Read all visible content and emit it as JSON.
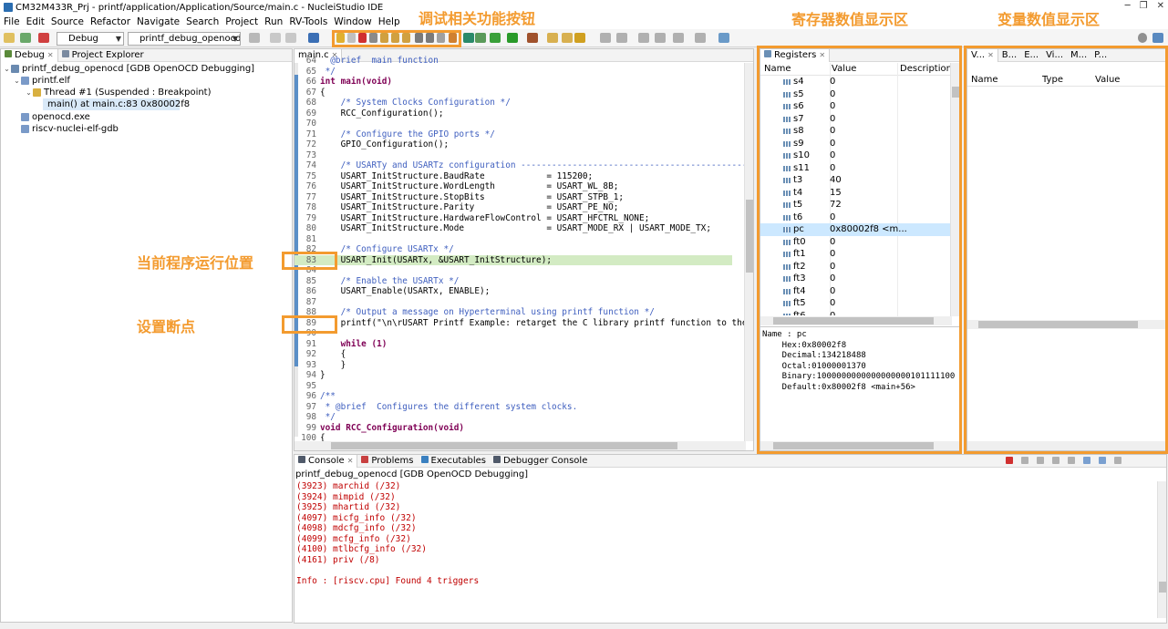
{
  "window": {
    "title": "CM32M433R_Prj - printf/application/Application/Source/main.c - NucleiStudio IDE"
  },
  "menu": [
    "File",
    "Edit",
    "Source",
    "Refactor",
    "Navigate",
    "Search",
    "Project",
    "Run",
    "RV-Tools",
    "Window",
    "Help"
  ],
  "toolbar": {
    "build_config": "Debug",
    "launch_config": "printf_debug_openocd"
  },
  "debug_view": {
    "tabs": [
      "Debug",
      "Project Explorer"
    ],
    "tree": [
      "printf_debug_openocd [GDB OpenOCD Debugging]",
      "printf.elf",
      "Thread #1 (Suspended : Breakpoint)",
      "main() at main.c:83 0x80002f8",
      "openocd.exe",
      "riscv-nuclei-elf-gdb"
    ]
  },
  "editor": {
    "tab": "main.c",
    "lines": [
      {
        "n": "64",
        "t": "  @brief  main function"
      },
      {
        "n": "65",
        "t": " */"
      },
      {
        "n": "66",
        "t": "int main(void)"
      },
      {
        "n": "67",
        "t": "{"
      },
      {
        "n": "68",
        "t": "    /* System Clocks Configuration */"
      },
      {
        "n": "69",
        "t": "    RCC_Configuration();"
      },
      {
        "n": "70",
        "t": ""
      },
      {
        "n": "71",
        "t": "    /* Configure the GPIO ports */"
      },
      {
        "n": "72",
        "t": "    GPIO_Configuration();"
      },
      {
        "n": "73",
        "t": ""
      },
      {
        "n": "74",
        "t": "    /* USARTy and USARTz configuration ------------------------------------------------"
      },
      {
        "n": "75",
        "t": "    USART_InitStructure.BaudRate            = 115200;"
      },
      {
        "n": "76",
        "t": "    USART_InitStructure.WordLength          = USART_WL_8B;"
      },
      {
        "n": "77",
        "t": "    USART_InitStructure.StopBits            = USART_STPB_1;"
      },
      {
        "n": "78",
        "t": "    USART_InitStructure.Parity              = USART_PE_NO;"
      },
      {
        "n": "79",
        "t": "    USART_InitStructure.HardwareFlowControl = USART_HFCTRL_NONE;"
      },
      {
        "n": "80",
        "t": "    USART_InitStructure.Mode                = USART_MODE_RX | USART_MODE_TX;"
      },
      {
        "n": "81",
        "t": ""
      },
      {
        "n": "82",
        "t": "    /* Configure USARTx */"
      },
      {
        "n": "83",
        "t": "    USART_Init(USARTx, &USART_InitStructure);"
      },
      {
        "n": "84",
        "t": ""
      },
      {
        "n": "85",
        "t": "    /* Enable the USARTx */"
      },
      {
        "n": "86",
        "t": "    USART_Enable(USARTx, ENABLE);"
      },
      {
        "n": "87",
        "t": ""
      },
      {
        "n": "88",
        "t": "    /* Output a message on Hyperterminal using printf function */"
      },
      {
        "n": "89",
        "t": "    printf(\"\\n\\rUSART Printf Example: retarget the C library printf function to the"
      },
      {
        "n": "90",
        "t": ""
      },
      {
        "n": "91",
        "t": "    while (1)"
      },
      {
        "n": "92",
        "t": "    {"
      },
      {
        "n": "93",
        "t": "    }"
      },
      {
        "n": "94",
        "t": "}"
      },
      {
        "n": "95",
        "t": ""
      },
      {
        "n": "96",
        "t": "/**"
      },
      {
        "n": "97",
        "t": " * @brief  Configures the different system clocks."
      },
      {
        "n": "98",
        "t": " */"
      },
      {
        "n": "99",
        "t": "void RCC_Configuration(void)"
      },
      {
        "n": "100",
        "t": "{"
      }
    ]
  },
  "registers": {
    "tab": "Registers",
    "columns": [
      "Name",
      "Value",
      "Description"
    ],
    "rows": [
      {
        "name": "s4",
        "value": "0"
      },
      {
        "name": "s5",
        "value": "0"
      },
      {
        "name": "s6",
        "value": "0"
      },
      {
        "name": "s7",
        "value": "0"
      },
      {
        "name": "s8",
        "value": "0"
      },
      {
        "name": "s9",
        "value": "0"
      },
      {
        "name": "s10",
        "value": "0"
      },
      {
        "name": "s11",
        "value": "0"
      },
      {
        "name": "t3",
        "value": "40"
      },
      {
        "name": "t4",
        "value": "15"
      },
      {
        "name": "t5",
        "value": "72"
      },
      {
        "name": "t6",
        "value": "0"
      },
      {
        "name": "pc",
        "value": "0x80002f8 <m..."
      },
      {
        "name": "ft0",
        "value": "0"
      },
      {
        "name": "ft1",
        "value": "0"
      },
      {
        "name": "ft2",
        "value": "0"
      },
      {
        "name": "ft3",
        "value": "0"
      },
      {
        "name": "ft4",
        "value": "0"
      },
      {
        "name": "ft5",
        "value": "0"
      },
      {
        "name": "ft6",
        "value": "0"
      }
    ],
    "detail": [
      "Name : pc",
      "    Hex:0x80002f8",
      "    Decimal:134218488",
      "    Octal:01000001370",
      "    Binary:1000000000000000000101111100",
      "    Default:0x80002f8 <main+56>"
    ]
  },
  "variables": {
    "tabs": [
      "V...",
      "B...",
      "E...",
      "Vi...",
      "M...",
      "P..."
    ],
    "columns": [
      "Name",
      "Type",
      "Value"
    ]
  },
  "console": {
    "tabs": [
      "Console",
      "Problems",
      "Executables",
      "Debugger Console"
    ],
    "header": "printf_debug_openocd [GDB OpenOCD Debugging]",
    "lines": [
      "(3923) marchid (/32)",
      "(3924) mimpid (/32)",
      "(3925) mhartid (/32)",
      "(4097) micfg_info (/32)",
      "(4098) mdcfg_info (/32)",
      "(4099) mcfg_info (/32)",
      "(4100) mtlbcfg_info (/32)",
      "(4161) priv (/8)",
      "",
      "Info : [riscv.cpu] Found 4 triggers"
    ]
  },
  "annotations": {
    "debug_buttons": "调试相关功能按钮",
    "register_area": "寄存器数值显示区",
    "variable_area": "变量数值显示区",
    "current_pos": "当前程序运行位置",
    "breakpoint": "设置断点"
  },
  "colors": {
    "annotation": "#f39b2f",
    "keyword": "#7f0055",
    "comment": "#3f5fbf",
    "field": "#0000c0",
    "console_text": "#c00000",
    "current_line": "#d3ebc3",
    "selected_row": "#cce8ff"
  }
}
